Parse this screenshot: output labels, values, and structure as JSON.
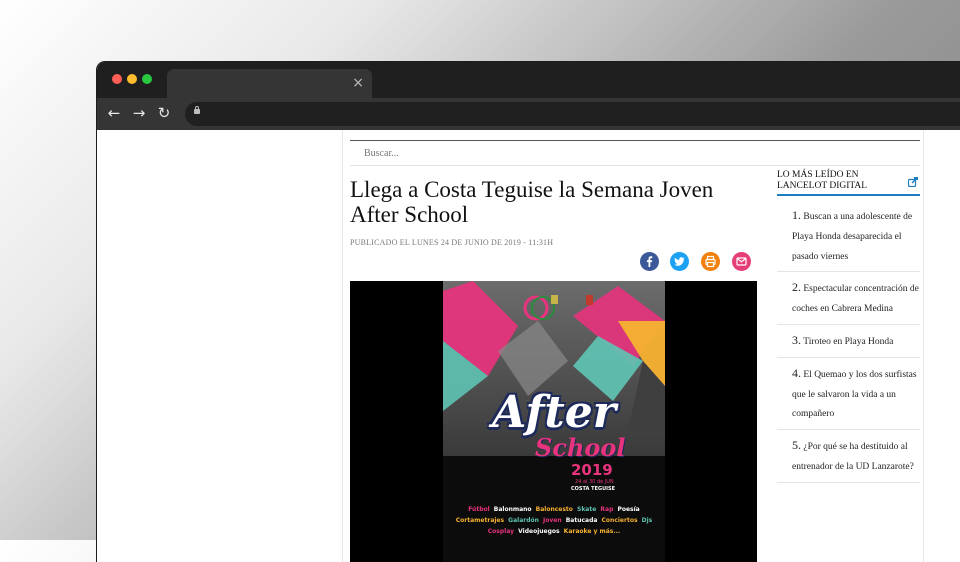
{
  "browser": {
    "tab_close": "×",
    "nav": {
      "back": "←",
      "forward": "→",
      "reload": "↻"
    }
  },
  "page": {
    "search": {
      "placeholder": "Buscar..."
    },
    "article": {
      "title": "Llega a Costa Teguise la Semana Joven After School",
      "meta": "Publicado el Lunes 24 de Junio de 2019 - 11:31h",
      "share_buttons": [
        "facebook-icon",
        "twitter-icon",
        "print-icon",
        "email-icon"
      ],
      "poster": {
        "logo_main": "After",
        "logo_sub": "School",
        "year": "2019",
        "dates": "24 al 30 de JUN",
        "place": "COSTA TEGUISE",
        "activities": [
          {
            "text": "Fútbol",
            "color": "#e8337d"
          },
          {
            "text": "Balonmano",
            "color": "#ffffff"
          },
          {
            "text": "Baloncesto",
            "color": "#f7b230"
          },
          {
            "text": "Skate",
            "color": "#5fc3b3"
          },
          {
            "text": "Rap",
            "color": "#e8337d"
          },
          {
            "text": "Poesía",
            "color": "#ffffff"
          },
          {
            "text": "Cortametrajes",
            "color": "#f7b230"
          },
          {
            "text": "Galardón",
            "color": "#5fc3b3"
          },
          {
            "text": "Joven",
            "color": "#e8337d"
          },
          {
            "text": "Batucada",
            "color": "#ffffff"
          },
          {
            "text": "Conciertos",
            "color": "#f7b230"
          },
          {
            "text": "Djs",
            "color": "#5fc3b3"
          },
          {
            "text": "Cosplay",
            "color": "#e8337d"
          },
          {
            "text": "Videojuegos",
            "color": "#ffffff"
          },
          {
            "text": "Karaoke y más...",
            "color": "#f7b230"
          }
        ]
      }
    },
    "sidebar": {
      "title": "Lo más leído en Lancelot Digital",
      "items": [
        {
          "num": "1.",
          "text": "Buscan a una adolescente de Playa Honda desaparecida el pasado viernes"
        },
        {
          "num": "2.",
          "text": "Espectacular concentración de coches en Cabrera Medina"
        },
        {
          "num": "3.",
          "text": "Tiroteo en Playa Honda"
        },
        {
          "num": "4.",
          "text": "El Quemao y los dos surfistas que le salvaron la vida a un compañero"
        },
        {
          "num": "5.",
          "text": "¿Por qué se ha destituido al entrenador de la UD Lanzarote?"
        }
      ]
    }
  },
  "colors": {
    "accent_blue": "#1c7fc4",
    "poster_pink": "#e8337d",
    "poster_teal": "#5fc3b3",
    "poster_orange": "#f7b230"
  }
}
